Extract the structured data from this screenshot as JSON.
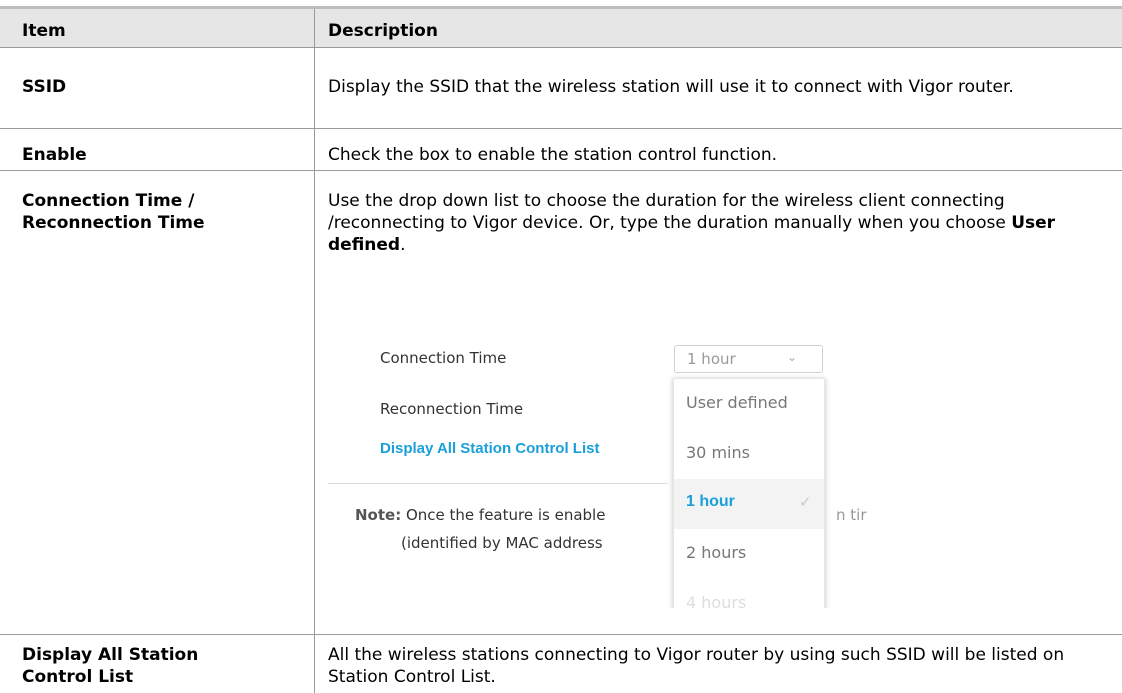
{
  "table": {
    "headers": {
      "item": "Item",
      "description": "Description"
    },
    "rows": [
      {
        "item": "SSID",
        "description": "Display the SSID that the wireless station will use it to connect with Vigor router."
      },
      {
        "item": "Enable",
        "description": "Check the box to enable the station control function."
      },
      {
        "item_line1": "Connection Time /",
        "item_line2": "Reconnection Time",
        "description_pre": "Use the drop down list to choose the duration for the wireless client connecting /reconnecting to Vigor device. Or, type the duration manually when you choose ",
        "description_bold": "User defined",
        "description_post": "."
      },
      {
        "item_line1": "Display All Station",
        "item_line2": "Control List",
        "description": "All the wireless stations connecting to Vigor router by using such SSID will be listed on Station Control List."
      }
    ]
  },
  "screenshot": {
    "connection_time_label": "Connection Time",
    "reconnection_time_label": "Reconnection Time",
    "link": "Display All Station Control List",
    "select_value": "1 hour",
    "options": [
      "User defined",
      "30 mins",
      "1 hour",
      "2 hours",
      "4 hours"
    ],
    "selected_option": "1 hour",
    "note_label": "Note:",
    "note_line1": "Once the feature is enable",
    "note_line1_tail": "n tir",
    "note_line2": "(identified by MAC address",
    "accent_color": "#1a9fd9"
  }
}
